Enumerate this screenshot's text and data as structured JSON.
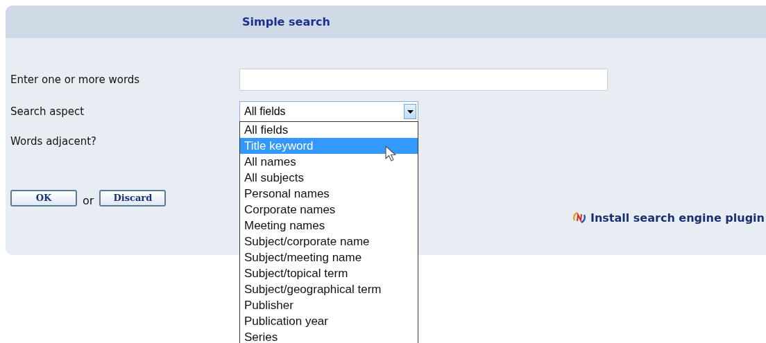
{
  "panel": {
    "title": "Simple search"
  },
  "fields": [
    {
      "kind": "text",
      "label": "Enter one or more words"
    },
    {
      "kind": "select",
      "label": "Search aspect",
      "value": "All fields",
      "expanded": true,
      "options": [
        {
          "label": "All fields",
          "highlighted": false
        },
        {
          "label": "Title keyword",
          "highlighted": true
        },
        {
          "label": "All names",
          "highlighted": false
        },
        {
          "label": "All subjects",
          "highlighted": false
        },
        {
          "label": "Personal names",
          "highlighted": false
        },
        {
          "label": "Corporate names",
          "highlighted": false
        },
        {
          "label": "Meeting names",
          "highlighted": false
        },
        {
          "label": "Subject/corporate name",
          "highlighted": false
        },
        {
          "label": "Subject/meeting name",
          "highlighted": false
        },
        {
          "label": "Subject/topical term",
          "highlighted": false
        },
        {
          "label": "Subject/geographical term",
          "highlighted": false
        },
        {
          "label": "Publisher",
          "highlighted": false
        },
        {
          "label": "Publication year",
          "highlighted": false
        },
        {
          "label": "Series",
          "highlighted": false
        }
      ]
    },
    {
      "kind": "label",
      "label": "Words adjacent?"
    }
  ],
  "actions": {
    "ok": "OK",
    "separator": "or",
    "discard": "Discard"
  },
  "plugin_link": "Install search engine plugin"
}
